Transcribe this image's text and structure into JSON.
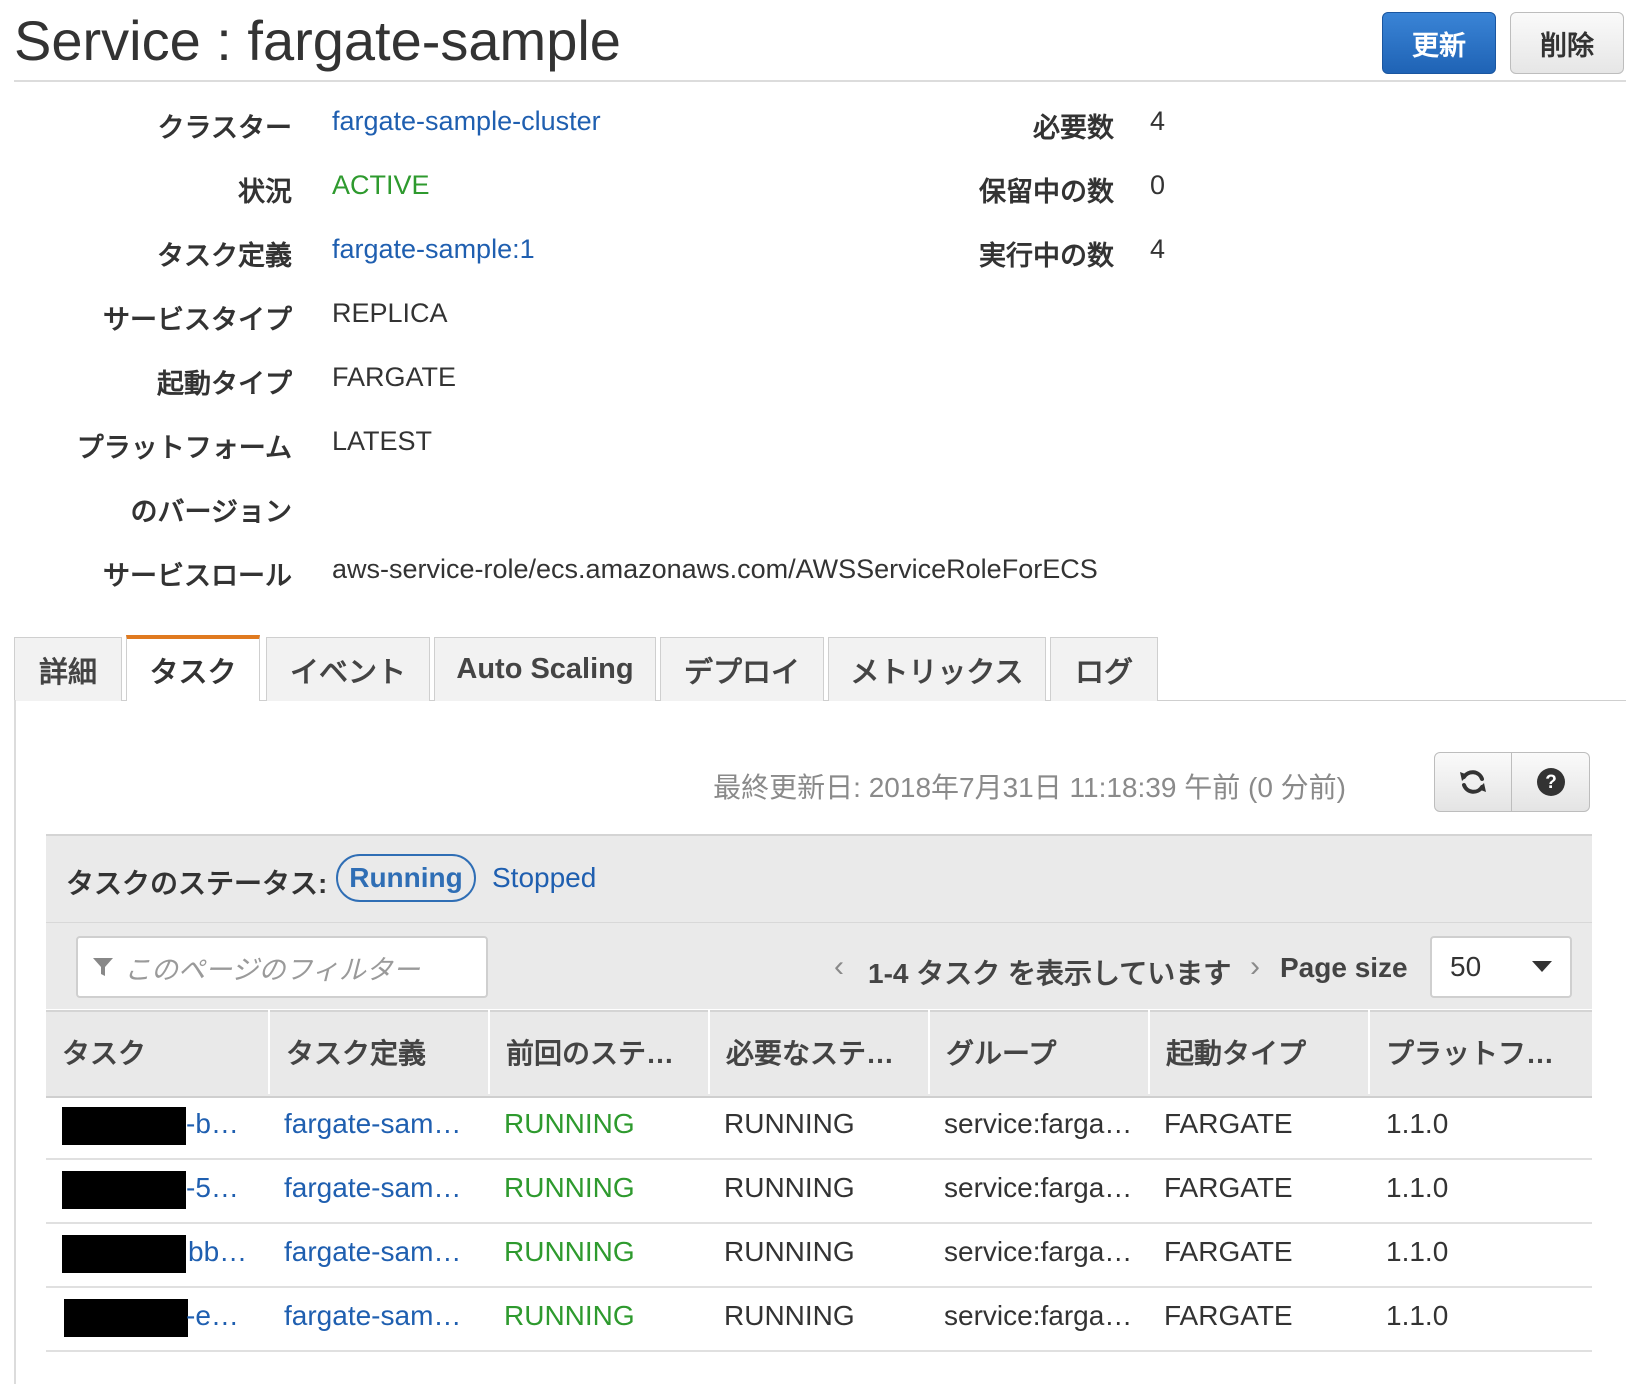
{
  "header": {
    "title": "Service : fargate-sample",
    "update_button": "更新",
    "delete_button": "削除"
  },
  "details": {
    "cluster_label": "クラスター",
    "cluster_value": "fargate-sample-cluster",
    "status_label": "状況",
    "status_value": "ACTIVE",
    "taskdef_label": "タスク定義",
    "taskdef_value": "fargate-sample:1",
    "service_type_label": "サービスタイプ",
    "service_type_value": "REPLICA",
    "launch_type_label": "起動タイプ",
    "launch_type_value": "FARGATE",
    "platform_label_line1": "プラットフォーム",
    "platform_label_line2": "のバージョン",
    "platform_value": "LATEST",
    "service_role_label": "サービスロール",
    "service_role_value": "aws-service-role/ecs.amazonaws.com/AWSServiceRoleForECS",
    "desired_label": "必要数",
    "desired_value": "4",
    "pending_label": "保留中の数",
    "pending_value": "0",
    "running_label": "実行中の数",
    "running_value": "4"
  },
  "tabs": [
    {
      "label": "詳細"
    },
    {
      "label": "タスク",
      "active": true
    },
    {
      "label": "イベント"
    },
    {
      "label": "Auto Scaling"
    },
    {
      "label": "デプロイ"
    },
    {
      "label": "メトリックス"
    },
    {
      "label": "ログ"
    }
  ],
  "toolbar": {
    "last_updated": "最終更新日: 2018年7月31日 11:18:39 午前 (0 分前)",
    "refresh_icon": "refresh-icon",
    "help_icon": "help-icon"
  },
  "task_status": {
    "label": "タスクのステータス:",
    "running": "Running",
    "stopped": "Stopped"
  },
  "filter": {
    "placeholder": "このページのフィルター",
    "pager_text": "1-4 タスク を表示しています",
    "page_size_label": "Page size",
    "page_size_value": "50"
  },
  "table": {
    "columns": [
      "タスク",
      "タスク定義",
      "前回のステ…",
      "必要なステ…",
      "グループ",
      "起動タイプ",
      "プラットフ…"
    ],
    "rows": [
      {
        "task": "-b…",
        "taskdef": "fargate-sam…",
        "last": "RUNNING",
        "desired": "RUNNING",
        "group": "service:farga…",
        "launch": "FARGATE",
        "platform": "1.1.0"
      },
      {
        "task": "-5…",
        "taskdef": "fargate-sam…",
        "last": "RUNNING",
        "desired": "RUNNING",
        "group": "service:farga…",
        "launch": "FARGATE",
        "platform": "1.1.0"
      },
      {
        "task": "bb…",
        "taskdef": "fargate-sam…",
        "last": "RUNNING",
        "desired": "RUNNING",
        "group": "service:farga…",
        "launch": "FARGATE",
        "platform": "1.1.0"
      },
      {
        "task": "-e…",
        "taskdef": "fargate-sam…",
        "last": "RUNNING",
        "desired": "RUNNING",
        "group": "service:farga…",
        "launch": "FARGATE",
        "platform": "1.1.0"
      }
    ]
  },
  "colors": {
    "link": "#1f5fb0",
    "active_green": "#2e9a2e",
    "primary_button": "#2a72c8",
    "tab_accent": "#e07a1f"
  }
}
